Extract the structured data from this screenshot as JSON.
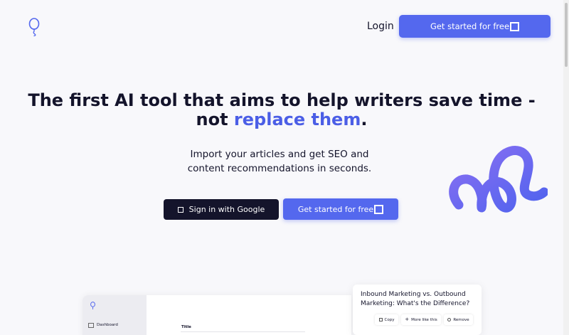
{
  "header": {
    "login_label": "Login",
    "cta_label": "Get started for free",
    "cta_icon": "box-glyph-icon"
  },
  "hero": {
    "headline_line1": "The first AI tool that aims to help writers save time -",
    "headline_line2_prefix": "not ",
    "headline_line2_accent": "replace them",
    "headline_line2_suffix": ".",
    "subtitle_line1": "Import your articles and get SEO and",
    "subtitle_line2": "content recommendations in seconds.",
    "google_button_label": "Sign in with Google",
    "free_button_label": "Get started for free"
  },
  "preview": {
    "sidebar_item": "Dashboard",
    "title_field_label": "Title",
    "card_title": "Inbound Marketing vs. Outbound Marketing: What's the Difference?",
    "actions": [
      {
        "label": "Copy",
        "icon": "copy-icon"
      },
      {
        "label": "More like this",
        "icon": "plus-icon"
      },
      {
        "label": "Remove",
        "icon": "remove-icon"
      }
    ]
  },
  "colors": {
    "accent": "#5468ee",
    "dark": "#14142b",
    "background": "#f8f8fb"
  }
}
